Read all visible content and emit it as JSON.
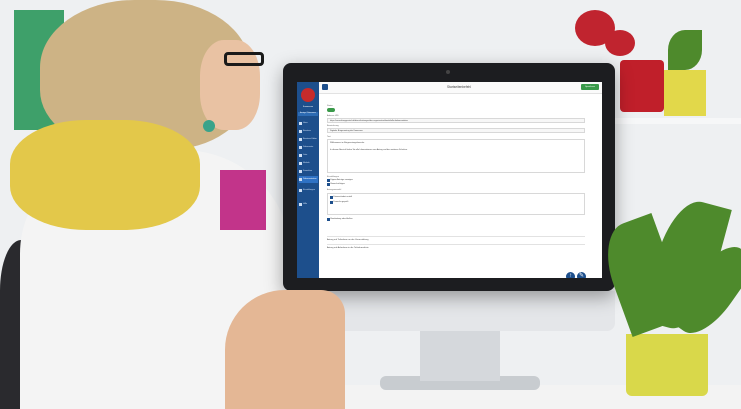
{
  "app": {
    "title": "Startseitenbefehl",
    "save_label": "Speichern",
    "brand": "Kommunen",
    "user": "Anzeige / Nutzername"
  },
  "sidebar": {
    "items": [
      {
        "label": "Haus",
        "icon": "home-icon"
      },
      {
        "label": "Benutzer",
        "icon": "user-icon"
      },
      {
        "label": "Benutzer Editor",
        "icon": "edit-icon"
      },
      {
        "label": "Dokumente",
        "icon": "document-icon"
      },
      {
        "label": "Liste",
        "icon": "list-icon"
      },
      {
        "label": "Module",
        "icon": "module-icon"
      },
      {
        "label": "Formulare",
        "icon": "form-icon"
      },
      {
        "label": "Dokumentation",
        "icon": "doc-icon"
      },
      {
        "label": "Einstellungen",
        "icon": "settings-icon"
      },
      {
        "label": "Hilfe",
        "icon": "help-icon"
      }
    ],
    "active_index": 7
  },
  "form": {
    "status_label": "Status",
    "url_label": "Adresse URL",
    "url_value": "https://verwaltungsportal.de/dienstleistungen/der-organisation/kombi/alle-dokumentation",
    "name_label": "Bezeichnung",
    "name_value": "Digitaler Bürgerantrag der Kommune",
    "text_label": "Text",
    "text_line1": "Willkommen im Bürgerantragsformular.",
    "text_line2": "In diesem Bereich finden Sie alle Informationen zum Antrag und den weiteren Schritten.",
    "options_label": "Einstellungen",
    "options": [
      "Eigene Anträge anzeigen",
      "Benachrichtigen"
    ],
    "section2_label": "Antragsauswahl",
    "checks": [
      "Einverständnis erteilt",
      "Formular geprüft"
    ],
    "footer_check": "Bearbeitung abschließen",
    "rows": [
      "Antrag auf Teilnahme an der Veranstaltung",
      "Antrag auf Aufnahme in die Teilnehmerliste"
    ]
  },
  "colors": {
    "accent": "#1d4f8c",
    "save": "#3a9a4a"
  }
}
